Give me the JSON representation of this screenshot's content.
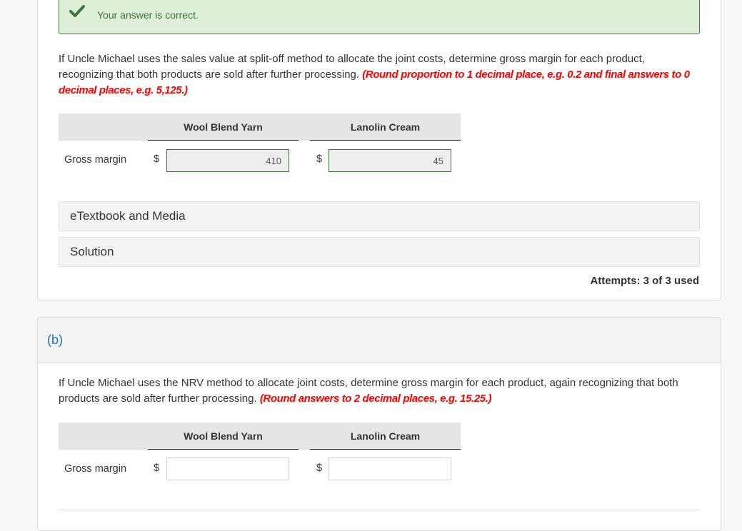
{
  "feedback": {
    "icon": "check-icon",
    "message": "Your answer is correct.",
    "color": "#3c763d"
  },
  "part_a": {
    "prompt": "If Uncle Michael uses the sales value at split-off method to allocate the joint costs, determine gross margin for each product, recognizing that both products are sold after further processing.",
    "hint": "(Round proportion to 1 decimal place, e.g. 0.2 and final answers to 0 decimal places, e.g. 5,125.)",
    "columns": [
      "Wool Blend Yarn",
      "Lanolin Cream"
    ],
    "row_label": "Gross margin",
    "currency": "$",
    "values": [
      "410",
      "45"
    ],
    "accordions": [
      "eTextbook and Media",
      "Solution"
    ],
    "attempts": "Attempts: 3 of 3 used"
  },
  "part_b": {
    "label": "(b)",
    "prompt": "If Uncle Michael uses the NRV method to allocate joint costs, determine gross margin for each product, again recognizing that both products are sold after further processing.",
    "hint": "(Round answers to 2 decimal places, e.g. 15.25.)",
    "columns": [
      "Wool Blend Yarn",
      "Lanolin Cream"
    ],
    "row_label": "Gross margin",
    "currency": "$",
    "values": [
      "",
      ""
    ]
  },
  "colors": {
    "hint": "#ff0000",
    "part_label": "#1b75bb",
    "correct_border": "#3c763d"
  }
}
